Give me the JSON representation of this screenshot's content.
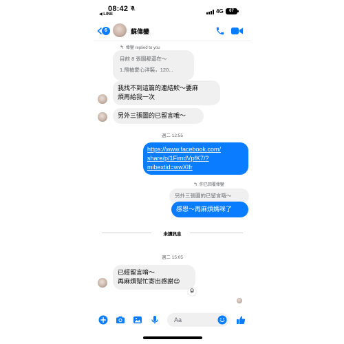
{
  "status_bar": {
    "time": "08:42",
    "back_app": "◀ LINE",
    "network": "4G",
    "battery": "67"
  },
  "header": {
    "unread_count": "6",
    "contact_name": "蘇偉鑾"
  },
  "messages": {
    "reply_note": "偉鑾 replied to you",
    "quoted_line1": "目前 8 張圖都還在～",
    "quoted_line2": "1.飛袖愛心洋裝，120...",
    "msg1_line1": "我找不到這篇的連結欸～要麻",
    "msg1_line2": "煩再給我一次",
    "msg2": "另外三張圖的已留言哦～",
    "timestamp1": "週二 12:55",
    "link_line1": "https://www.facebook.com/",
    "link_line2": "share/p/1FimdVpfK7/?",
    "link_line3": "mibextid=wwXIfr",
    "my_reply_note": "你已回覆偉鑾",
    "my_quoted": "另外三張圖的已留言哦～",
    "my_reply": "感恩～再麻煩媽咪了",
    "unread_label": "未讀訊息",
    "timestamp2": "週二 15:05",
    "msg3_line1": "已經留言唷～",
    "msg3_line2": "再麻煩幫忙寄出感謝😊"
  },
  "composer": {
    "placeholder": "Aa"
  },
  "colors": {
    "accent": "#0a7cff",
    "incoming_bubble": "#f0f0f0"
  }
}
